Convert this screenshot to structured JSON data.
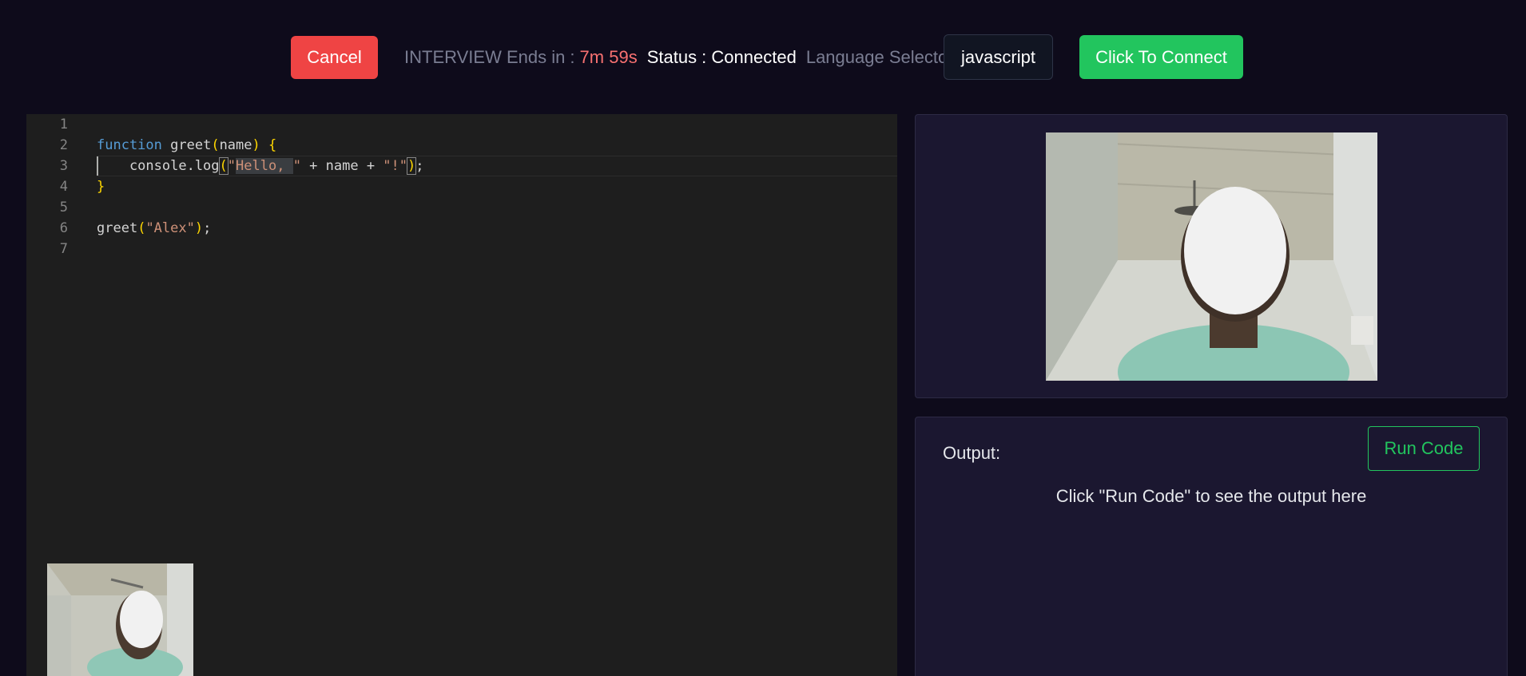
{
  "topbar": {
    "cancel_label": "Cancel",
    "interview_label": "INTERVIEW Ends in :",
    "timer": "7m 59s",
    "status": "Status : Connected",
    "language_label": "Language Selector :",
    "language_value": "javascript",
    "connect_label": "Click To Connect"
  },
  "editor": {
    "line_numbers": [
      "1",
      "2",
      "3",
      "4",
      "5",
      "6",
      "7"
    ],
    "lines": {
      "l2_kw": "function",
      "l2_name": " greet",
      "l2_po": "(",
      "l2_param": "name",
      "l2_pc": ")",
      "l2_space": " ",
      "l2_brace": "{",
      "l3_indent": "    console.log",
      "l3_po": "(",
      "l3_q": "\"",
      "l3_sel": "Hello, ",
      "l3_q2": "\"",
      "l3_mid": " + name + ",
      "l3_excl": "\"!\"",
      "l3_pc": ")",
      "l3_semi": ";",
      "l4_brace": "}",
      "l6_fn": "greet",
      "l6_po": "(",
      "l6_str": "\"Alex\"",
      "l6_pc": ")",
      "l6_semi": ";"
    }
  },
  "output": {
    "label": "Output:",
    "run_label": "Run Code",
    "hint": "Click \"Run Code\" to see the output here"
  },
  "colors": {
    "background": "#0e0b1b",
    "cancel": "#ef4444",
    "connect": "#22c55e",
    "timer": "#f87171",
    "panel": "#1b1730",
    "editor": "#1e1e1e"
  },
  "icons": [
    "remote-video-feed",
    "self-video-feed"
  ]
}
